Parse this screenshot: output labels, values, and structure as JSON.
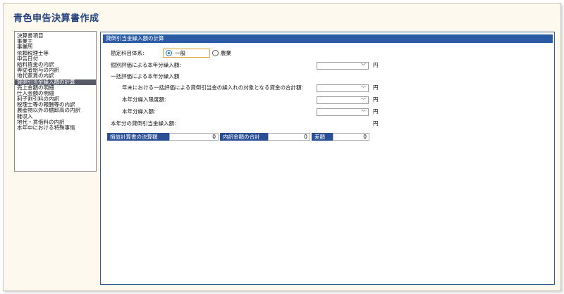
{
  "app": {
    "title": "青色申告決算書作成"
  },
  "sidebar": {
    "items": [
      "決算書項目",
      "事業主",
      "事業所",
      "依頼税理士等",
      "申告日付",
      "給料賃金の内訳",
      "専従者給与の内訳",
      "地代家賃の内訳",
      "貸倒引当金繰入額の計算",
      "売上金額の明細",
      "仕入金額の明細",
      "利子割引料の内訳",
      "税理士等の報酬等の内訳",
      "農産物以外の棚卸高の内訳",
      "雑収入",
      "地代・賃借料の内訳",
      "本年中における特殊事情"
    ],
    "selected_index": 8
  },
  "section": {
    "title": "貸倒引当金繰入額の計算"
  },
  "form": {
    "kanjo_label": "勘定科目体系:",
    "radio_ippan": "一般",
    "radio_nogyo": "農業",
    "kobetsu_label": "個別評価による本年分繰入額:",
    "ikkatsu_label": "一括評価による本年分繰入額",
    "nenmatsu_label": "年末における一括評価による貸倒引当金の繰入れの対象となる貸金の合計額:",
    "gendo_label": "本年分繰入限度額:",
    "kuriire_label": "本年分繰入額:",
    "total_label": "本年分の貸倒引当金繰入額:",
    "unit": "円"
  },
  "summary": {
    "kessan_label": "損益計算書の決算額",
    "kessan_value": "0",
    "uchiwake_label": "内訳金額の合計",
    "uchiwake_value": "0",
    "sagaku_label": "差額",
    "sagaku_value": "0"
  },
  "colors": {
    "header": "#2a5aa6",
    "title": "#1e3f7a",
    "background": "#fdf9ee"
  }
}
